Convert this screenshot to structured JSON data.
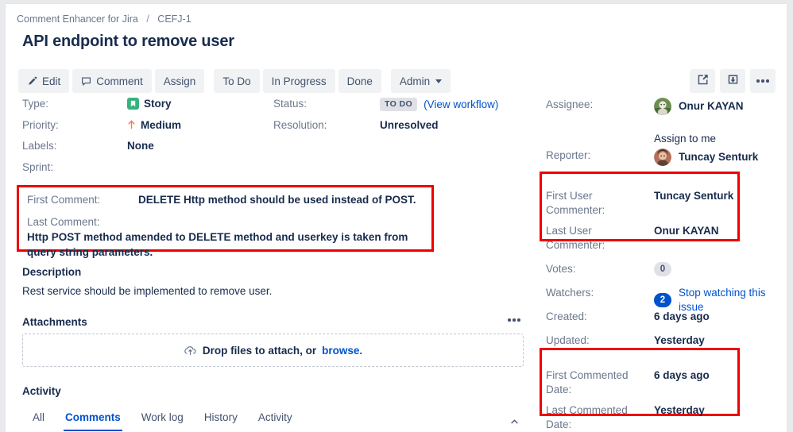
{
  "breadcrumb": {
    "project": "Comment Enhancer for Jira",
    "separator": "/",
    "issue_key": "CEFJ-1"
  },
  "title": "API endpoint to remove user",
  "toolbar": {
    "edit": "Edit",
    "comment": "Comment",
    "assign": "Assign",
    "todo": "To Do",
    "in_progress": "In Progress",
    "done": "Done",
    "admin": "Admin"
  },
  "details": {
    "type_label": "Type:",
    "type_value": "Story",
    "priority_label": "Priority:",
    "priority_value": "Medium",
    "labels_label": "Labels:",
    "labels_value": "None",
    "sprint_label": "Sprint:",
    "sprint_value": "",
    "status_label": "Status:",
    "status_value": "TO DO",
    "view_workflow": "(View workflow)",
    "resolution_label": "Resolution:",
    "resolution_value": "Unresolved"
  },
  "comment_fields": {
    "first_label": "First Comment:",
    "first_value": "DELETE Http method should be used instead of POST.",
    "last_label": "Last Comment:",
    "last_value": "Http POST method amended to DELETE method and userkey is taken from query string parameters."
  },
  "description": {
    "heading": "Description",
    "body": "Rest service should be implemented to remove user."
  },
  "attachments": {
    "heading": "Attachments",
    "dropzone_text": "Drop files to attach, or",
    "browse_link": "browse."
  },
  "activity": {
    "heading": "Activity",
    "tabs": [
      {
        "label": "All",
        "active": false
      },
      {
        "label": "Comments",
        "active": true
      },
      {
        "label": "Work log",
        "active": false
      },
      {
        "label": "History",
        "active": false
      },
      {
        "label": "Activity",
        "active": false
      }
    ]
  },
  "people": {
    "assignee_label": "Assignee:",
    "assignee_value": "Onur KAYAN",
    "assign_to_me": "Assign to me",
    "reporter_label": "Reporter:",
    "reporter_value": "Tuncay Senturk",
    "first_commenter_label": "First User Commenter:",
    "first_commenter_value": "Tuncay Senturk",
    "last_commenter_label": "Last User Commenter:",
    "last_commenter_value": "Onur KAYAN"
  },
  "stats": {
    "votes_label": "Votes:",
    "votes_value": "0",
    "watchers_label": "Watchers:",
    "watchers_value": "2",
    "watch_link": "Stop watching this issue",
    "created_label": "Created:",
    "created_value": "6 days ago",
    "updated_label": "Updated:",
    "updated_value": "Yesterday",
    "first_commented_label": "First Commented Date:",
    "first_commented_value": "6 days ago",
    "last_commented_label": "Last Commented Date:",
    "last_commented_value": "Yesterday"
  },
  "colors": {
    "link": "#0052cc",
    "text": "#172b4d",
    "muted": "#6b778c",
    "highlight": "#ee0000",
    "story_green": "#36b37e",
    "priority_orange": "#ff7452",
    "badge_gray": "#dfe1e6"
  }
}
